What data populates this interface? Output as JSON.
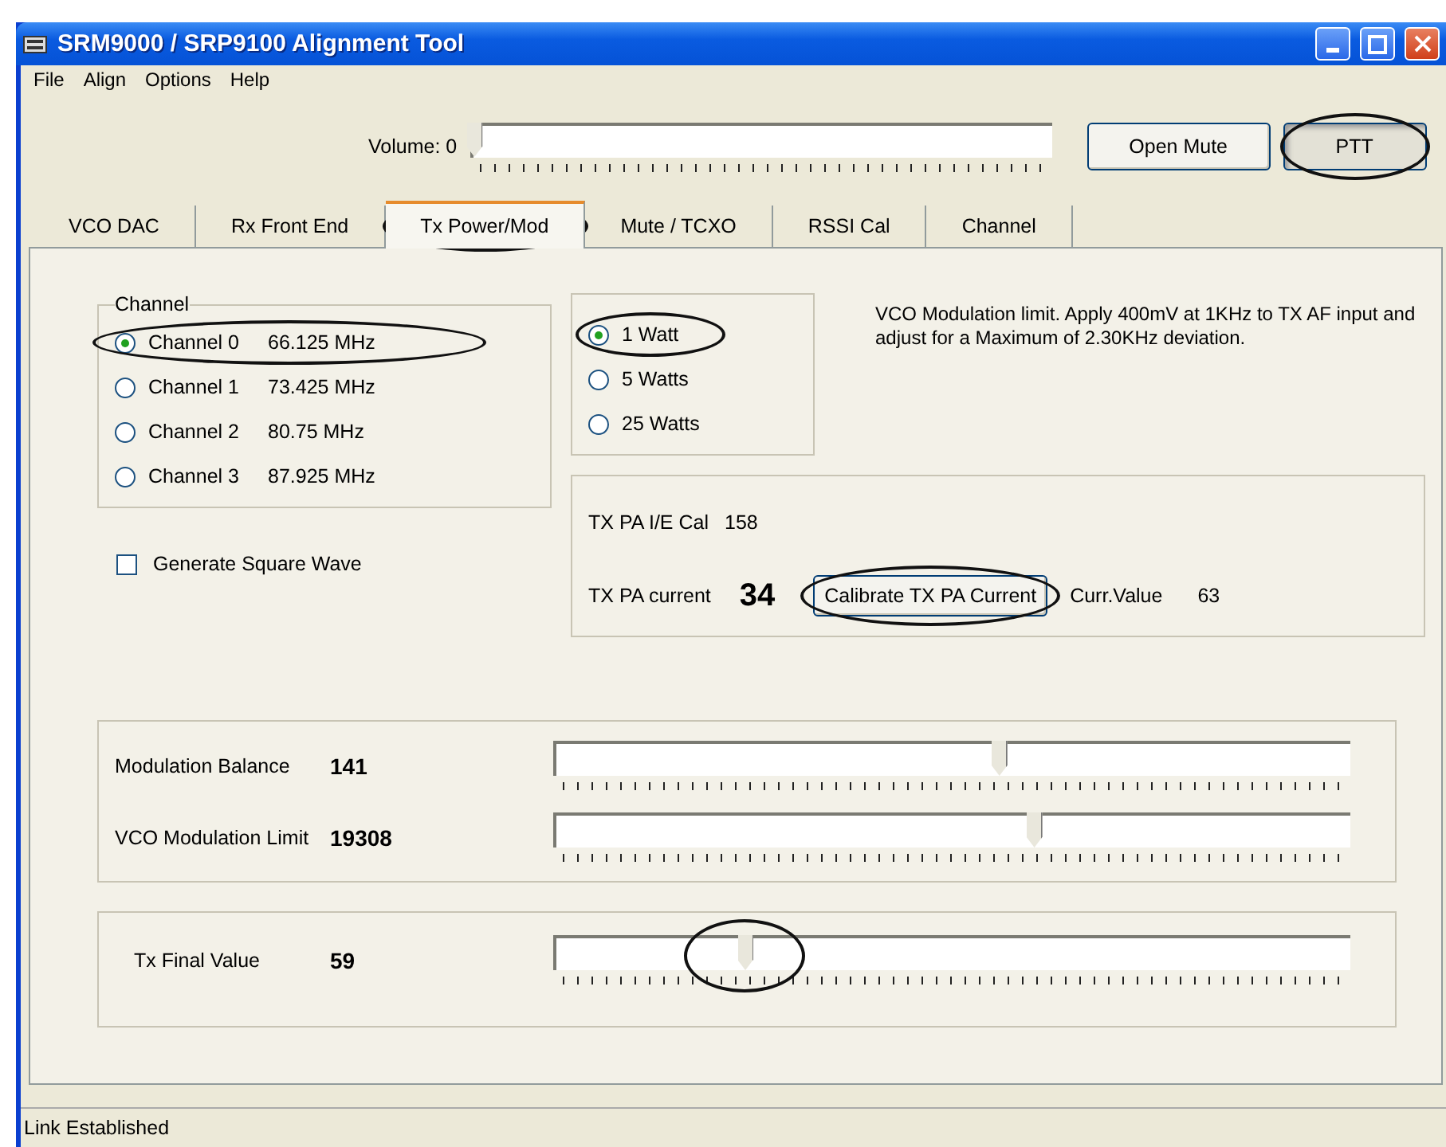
{
  "window": {
    "title": "SRM9000 / SRP9100 Alignment Tool"
  },
  "menu": [
    "File",
    "Align",
    "Options",
    "Help"
  ],
  "toolbar": {
    "volume": {
      "label": "Volume: 0",
      "level": 0
    },
    "buttons": [
      {
        "label": "Open Mute",
        "pressed": false,
        "highlighted": false
      },
      {
        "label": "PTT",
        "pressed": true,
        "highlighted": true
      }
    ]
  },
  "tabs": [
    {
      "label": "VCO DAC",
      "selected": false,
      "highlighted": false
    },
    {
      "label": "Rx Front End",
      "selected": false,
      "highlighted": false
    },
    {
      "label": "Tx Power/Mod",
      "selected": true,
      "highlighted": true
    },
    {
      "label": "Mute / TCXO",
      "selected": false,
      "highlighted": false
    },
    {
      "label": "RSSI Cal",
      "selected": false,
      "highlighted": false
    },
    {
      "label": "Channel",
      "selected": false,
      "highlighted": false
    }
  ],
  "channel_group": {
    "title": "Channel",
    "options": [
      {
        "name": "Channel 0",
        "frequency": "66.125 MHz",
        "selected": true,
        "highlighted": true
      },
      {
        "name": "Channel 1",
        "frequency": "73.425 MHz",
        "selected": false,
        "highlighted": false
      },
      {
        "name": "Channel 2",
        "frequency": "80.75 MHz",
        "selected": false,
        "highlighted": false
      },
      {
        "name": "Channel 3",
        "frequency": "87.925 MHz",
        "selected": false,
        "highlighted": false
      }
    ]
  },
  "square_wave": {
    "label": "Generate Square Wave",
    "checked": false
  },
  "power_options": [
    {
      "label": "1 Watt",
      "selected": true,
      "highlighted": true
    },
    {
      "label": "5 Watts",
      "selected": false,
      "highlighted": false
    },
    {
      "label": "25 Watts",
      "selected": false,
      "highlighted": false
    }
  ],
  "description": "VCO Modulation limit. Apply 400mV at 1KHz to TX AF input and adjust for a Maximum of 2.30KHz deviation.",
  "tx_pa": {
    "cal_label": "TX PA  I/E Cal",
    "cal_value": "158",
    "current_label": "TX PA current",
    "current_value": "34",
    "calibrate_button": {
      "label": "Calibrate TX PA Current",
      "highlighted": true
    },
    "curr_label": "Curr.Value",
    "curr_value": "63"
  },
  "sliders": [
    {
      "label": "Modulation Balance",
      "value": "141",
      "level": 0.556,
      "highlighted": false
    },
    {
      "label": "VCO Modulation Limit",
      "value": "19308",
      "level": 0.6,
      "highlighted": false
    }
  ],
  "final_slider": {
    "label": "Tx Final Value",
    "value": "59",
    "level": 0.236,
    "highlighted": true
  },
  "status_bar": "Link Established"
}
